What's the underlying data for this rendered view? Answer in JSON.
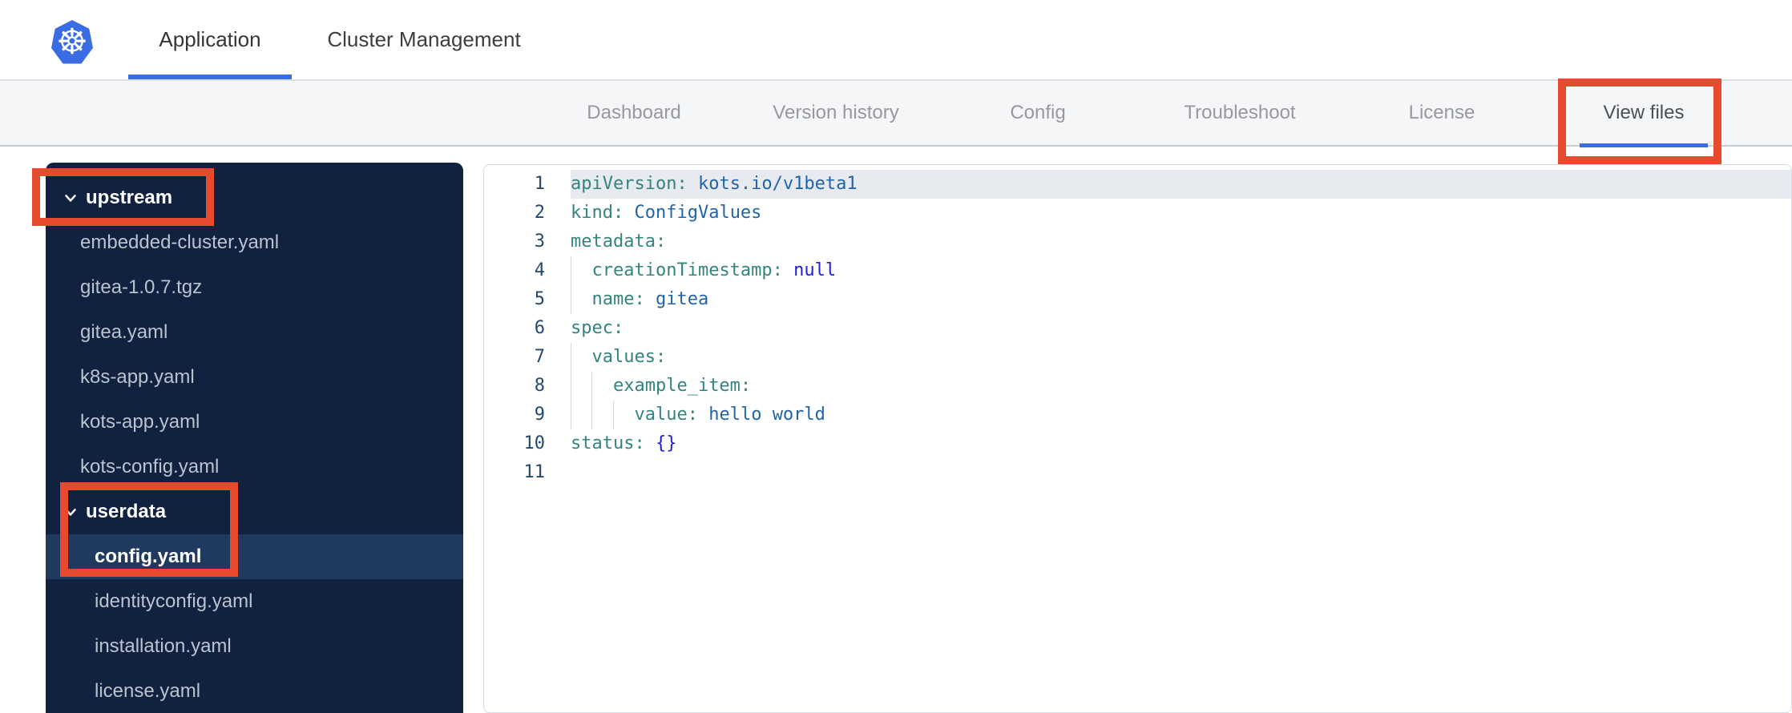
{
  "header": {
    "logo_icon": "kubernetes-helm-wheel",
    "tabs": [
      {
        "label": "Application",
        "active": true
      },
      {
        "label": "Cluster Management",
        "active": false
      }
    ]
  },
  "subnav": {
    "tabs": [
      {
        "label": "Dashboard",
        "active": false
      },
      {
        "label": "Version history",
        "active": false
      },
      {
        "label": "Config",
        "active": false
      },
      {
        "label": "Troubleshoot",
        "active": false
      },
      {
        "label": "License",
        "active": false
      },
      {
        "label": "View files",
        "active": true
      }
    ]
  },
  "sidebar": {
    "items": [
      {
        "label": "upstream",
        "type": "folder",
        "expanded": true,
        "level": 0,
        "selected": false
      },
      {
        "label": "embedded-cluster.yaml",
        "type": "file",
        "level": 1,
        "selected": false
      },
      {
        "label": "gitea-1.0.7.tgz",
        "type": "file",
        "level": 1,
        "selected": false
      },
      {
        "label": "gitea.yaml",
        "type": "file",
        "level": 1,
        "selected": false
      },
      {
        "label": "k8s-app.yaml",
        "type": "file",
        "level": 1,
        "selected": false
      },
      {
        "label": "kots-app.yaml",
        "type": "file",
        "level": 1,
        "selected": false
      },
      {
        "label": "kots-config.yaml",
        "type": "file",
        "level": 1,
        "selected": false
      },
      {
        "label": "userdata",
        "type": "folder",
        "expanded": true,
        "level": 0,
        "selected": false
      },
      {
        "label": "config.yaml",
        "type": "file",
        "level": 2,
        "selected": true
      },
      {
        "label": "identityconfig.yaml",
        "type": "file",
        "level": 2,
        "selected": false
      },
      {
        "label": "installation.yaml",
        "type": "file",
        "level": 2,
        "selected": false
      },
      {
        "label": "license.yaml",
        "type": "file",
        "level": 2,
        "selected": false
      }
    ]
  },
  "editor": {
    "language": "yaml",
    "lines": [
      {
        "num": "1",
        "selected": true,
        "guides": 0,
        "segments": [
          {
            "text": "apiVersion:",
            "type": "key"
          },
          {
            "text": " ",
            "type": "plain"
          },
          {
            "text": "kots.io/v1beta1",
            "type": "value"
          }
        ]
      },
      {
        "num": "2",
        "selected": false,
        "guides": 0,
        "segments": [
          {
            "text": "kind:",
            "type": "key"
          },
          {
            "text": " ",
            "type": "plain"
          },
          {
            "text": "ConfigValues",
            "type": "value"
          }
        ]
      },
      {
        "num": "3",
        "selected": false,
        "guides": 0,
        "segments": [
          {
            "text": "metadata:",
            "type": "key"
          }
        ]
      },
      {
        "num": "4",
        "selected": false,
        "guides": 1,
        "segments": [
          {
            "text": "  ",
            "type": "plain"
          },
          {
            "text": "creationTimestamp:",
            "type": "key"
          },
          {
            "text": " ",
            "type": "plain"
          },
          {
            "text": "null",
            "type": "keyword"
          }
        ]
      },
      {
        "num": "5",
        "selected": false,
        "guides": 1,
        "segments": [
          {
            "text": "  ",
            "type": "plain"
          },
          {
            "text": "name:",
            "type": "key"
          },
          {
            "text": " ",
            "type": "plain"
          },
          {
            "text": "gitea",
            "type": "value"
          }
        ]
      },
      {
        "num": "6",
        "selected": false,
        "guides": 0,
        "segments": [
          {
            "text": "spec:",
            "type": "key"
          }
        ]
      },
      {
        "num": "7",
        "selected": false,
        "guides": 1,
        "segments": [
          {
            "text": "  ",
            "type": "plain"
          },
          {
            "text": "values:",
            "type": "key"
          }
        ]
      },
      {
        "num": "8",
        "selected": false,
        "guides": 2,
        "segments": [
          {
            "text": "    ",
            "type": "plain"
          },
          {
            "text": "example_item:",
            "type": "key"
          }
        ]
      },
      {
        "num": "9",
        "selected": false,
        "guides": 3,
        "segments": [
          {
            "text": "      ",
            "type": "plain"
          },
          {
            "text": "value:",
            "type": "key"
          },
          {
            "text": " ",
            "type": "plain"
          },
          {
            "text": "hello world",
            "type": "value"
          }
        ]
      },
      {
        "num": "10",
        "selected": false,
        "guides": 0,
        "segments": [
          {
            "text": "status:",
            "type": "key"
          },
          {
            "text": " ",
            "type": "plain"
          },
          {
            "text": "{}",
            "type": "keyword"
          }
        ]
      },
      {
        "num": "11",
        "selected": false,
        "guides": 0,
        "segments": []
      }
    ]
  },
  "annotations": {
    "color": "#e84a2e",
    "boxes": [
      {
        "target": "view-files-tab"
      },
      {
        "target": "upstream-folder"
      },
      {
        "target": "userdata-config-yaml"
      }
    ]
  },
  "colors": {
    "accent_blue": "#3a6de4",
    "logo_blue": "#3a6de4",
    "sidebar_bg": "#112140",
    "sidebar_selected_bg": "#1f3a5e",
    "subnav_bg": "#f4f6f8",
    "annotation_red": "#e84a2e",
    "yaml_key": "#35837f",
    "yaml_value": "#2264a7",
    "yaml_keyword": "#1e1ed6",
    "line_number": "#25496b"
  }
}
